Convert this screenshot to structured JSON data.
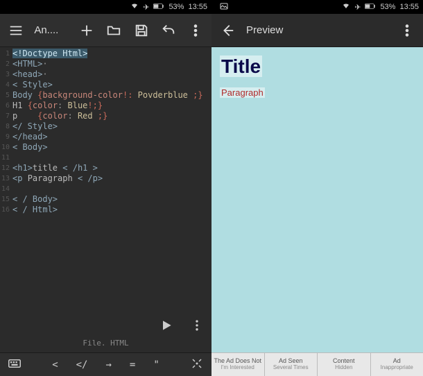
{
  "status": {
    "battery": "53%",
    "time": "13:55"
  },
  "editor": {
    "app_title": "An....",
    "file_label": "File. HTML",
    "lines": [
      {
        "n": 1,
        "html": "<span class='hl'>&lt;!Doctype Html&gt;</span>"
      },
      {
        "n": 2,
        "html": "<span class='tag'>&lt;HTML&gt;</span>·"
      },
      {
        "n": 3,
        "html": "<span class='tag'>&lt;head&gt;</span>·"
      },
      {
        "n": 4,
        "html": "<span class='tag'>&lt; Style&gt;</span>"
      },
      {
        "n": 5,
        "html": "<span class='tag'>Body</span> <span class='punc'>{</span><span class='prop'>background-color</span><span class='punc'>!:</span> <span class='val'>Povderblue</span><span class='punc'> ;}</span>"
      },
      {
        "n": 6,
        "html": "<span class='txt'>H1 </span><span class='punc'>{</span><span class='prop'>color</span>: <span class='val'>Blue</span><span class='punc'>!;}</span>"
      },
      {
        "n": 7,
        "html": "<span class='txt'>p    </span><span class='punc'>{</span><span class='prop'>color</span>: <span class='val'>Red</span><span class='punc'> ;}</span>"
      },
      {
        "n": 8,
        "html": "<span class='tag'>&lt;/ Style&gt;</span>"
      },
      {
        "n": 9,
        "html": "<span class='tag'>&lt;/head&gt;</span>"
      },
      {
        "n": 10,
        "html": "<span class='tag'>&lt; Body&gt;</span>"
      },
      {
        "n": 11,
        "html": ""
      },
      {
        "n": 12,
        "html": "<span class='tag'>&lt;h1&gt;</span><span class='txt'>title </span><span class='tag'>&lt; /h1 &gt;</span>"
      },
      {
        "n": 13,
        "html": "<span class='tag'>&lt;p </span><span class='txt'>Paragraph </span><span class='tag'>&lt; /p&gt;</span>"
      },
      {
        "n": 14,
        "html": ""
      },
      {
        "n": 15,
        "html": "<span class='tag'>&lt; / Body&gt;</span>"
      },
      {
        "n": 16,
        "html": "<span class='tag'>&lt; / Html&gt;</span>"
      }
    ],
    "symbols": [
      "<",
      "</",
      "→",
      "=",
      "\""
    ]
  },
  "preview": {
    "toolbar_title": "Preview",
    "title_text": "Title",
    "paragraph_text": "Paragraph"
  },
  "ads": [
    {
      "line1": "The Ad Does Not",
      "line2": "I'm Interested"
    },
    {
      "line1": "Ad Seen",
      "line2": "Several Times"
    },
    {
      "line1": "Content",
      "line2": "Hidden"
    },
    {
      "line1": "Ad",
      "line2": "Inappropriate"
    }
  ]
}
